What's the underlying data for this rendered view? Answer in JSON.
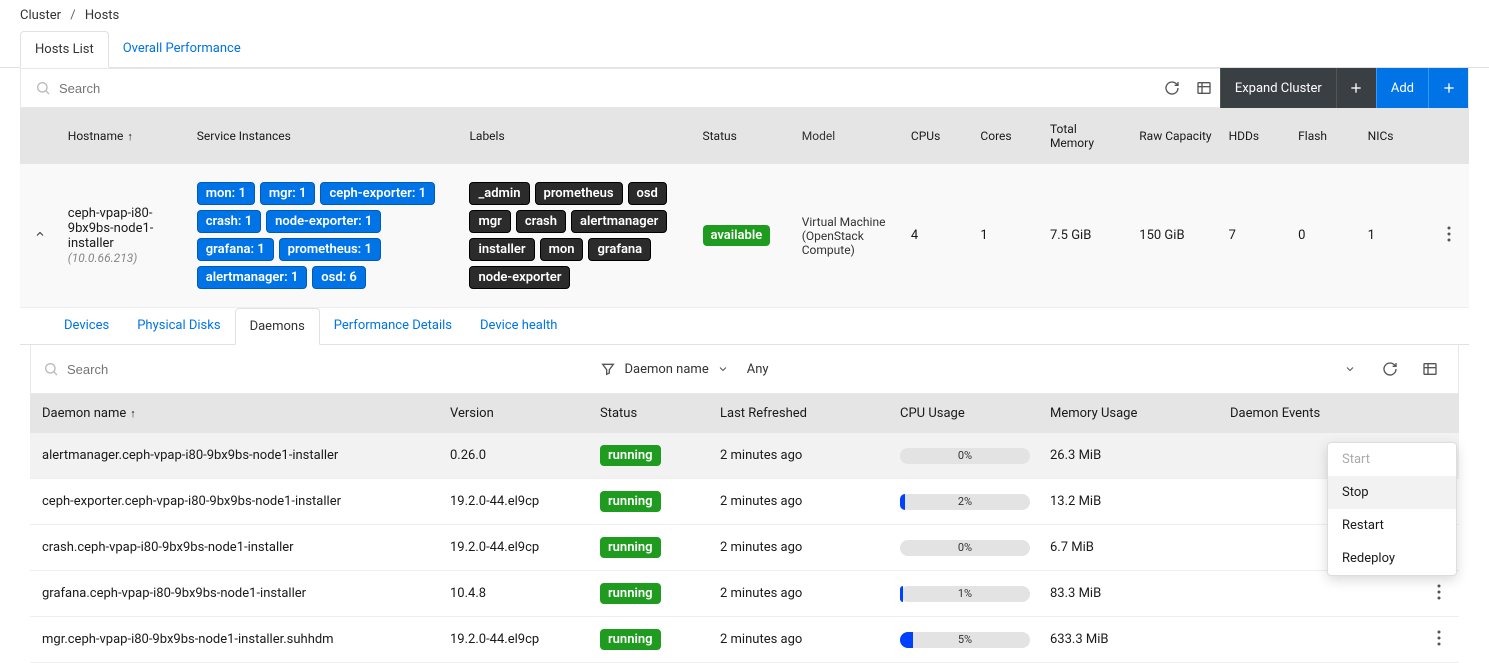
{
  "breadcrumb": {
    "root": "Cluster",
    "current": "Hosts"
  },
  "mainTabs": {
    "hostsList": "Hosts List",
    "overallPerf": "Overall Performance"
  },
  "search": {
    "placeholder": "Search"
  },
  "actions": {
    "expand": "Expand Cluster",
    "add": "Add"
  },
  "columns": {
    "hostname": "Hostname",
    "services": "Service Instances",
    "labels": "Labels",
    "status": "Status",
    "model": "Model",
    "cpus": "CPUs",
    "cores": "Cores",
    "totalMem": "Total Memory",
    "rawCap": "Raw Capacity",
    "hdds": "HDDs",
    "flash": "Flash",
    "nics": "NICs"
  },
  "host": {
    "name": "ceph-vpap-i80-9bx9bs-node1-installer",
    "ip": "(10.0.66.213)",
    "services": [
      "mon: 1",
      "mgr: 1",
      "ceph-exporter: 1",
      "crash: 1",
      "node-exporter: 1",
      "grafana: 1",
      "prometheus: 1",
      "alertmanager: 1",
      "osd: 6"
    ],
    "labels": [
      "_admin",
      "prometheus",
      "osd",
      "mgr",
      "crash",
      "alertmanager",
      "installer",
      "mon",
      "grafana",
      "node-exporter"
    ],
    "status": "available",
    "model": "Virtual Machine (OpenStack Compute)",
    "cpus": "4",
    "cores": "1",
    "totalMem": "7.5 GiB",
    "rawCap": "150 GiB",
    "hdds": "7",
    "flash": "0",
    "nics": "1"
  },
  "subTabs": {
    "devices": "Devices",
    "physDisks": "Physical Disks",
    "daemons": "Daemons",
    "perfDetails": "Performance Details",
    "devHealth": "Device health"
  },
  "daemonFilter": {
    "label": "Daemon name",
    "value": "Any",
    "placeholder": "Search"
  },
  "daemonCols": {
    "name": "Daemon name",
    "version": "Version",
    "status": "Status",
    "refreshed": "Last Refreshed",
    "cpu": "CPU Usage",
    "mem": "Memory Usage",
    "events": "Daemon Events"
  },
  "daemons": [
    {
      "name": "alertmanager.ceph-vpap-i80-9bx9bs-node1-installer",
      "version": "0.26.0",
      "status": "running",
      "refreshed": "2 minutes ago",
      "cpu": "0%",
      "cpuWidth": "0%",
      "mem": "26.3 MiB"
    },
    {
      "name": "ceph-exporter.ceph-vpap-i80-9bx9bs-node1-installer",
      "version": "19.2.0-44.el9cp",
      "status": "running",
      "refreshed": "2 minutes ago",
      "cpu": "2%",
      "cpuWidth": "4%",
      "mem": "13.2 MiB"
    },
    {
      "name": "crash.ceph-vpap-i80-9bx9bs-node1-installer",
      "version": "19.2.0-44.el9cp",
      "status": "running",
      "refreshed": "2 minutes ago",
      "cpu": "0%",
      "cpuWidth": "0%",
      "mem": "6.7 MiB"
    },
    {
      "name": "grafana.ceph-vpap-i80-9bx9bs-node1-installer",
      "version": "10.4.8",
      "status": "running",
      "refreshed": "2 minutes ago",
      "cpu": "1%",
      "cpuWidth": "2%",
      "mem": "83.3 MiB"
    },
    {
      "name": "mgr.ceph-vpap-i80-9bx9bs-node1-installer.suhhdm",
      "version": "19.2.0-44.el9cp",
      "status": "running",
      "refreshed": "2 minutes ago",
      "cpu": "5%",
      "cpuWidth": "10%",
      "mem": "633.3 MiB"
    }
  ],
  "menu": {
    "start": "Start",
    "stop": "Stop",
    "restart": "Restart",
    "redeploy": "Redeploy"
  }
}
